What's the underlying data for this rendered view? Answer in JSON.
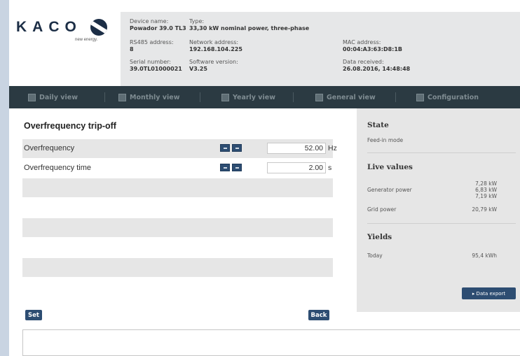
{
  "brand": {
    "logo_text": "KACO",
    "tagline": "new energy."
  },
  "device": {
    "name_label": "Device name:",
    "name_value": "Powador 39.0 TL3",
    "type_label": "Type:",
    "type_value": "33,30 kW nominal power, three-phase",
    "rs485_label": "RS485 address:",
    "rs485_value": "8",
    "network_label": "Network address:",
    "network_value": "192.168.104.225",
    "mac_label": "MAC address:",
    "mac_value": "00:04:A3:63:D8:1B",
    "serial_label": "Serial number:",
    "serial_value": "39.0TL01000021",
    "software_label": "Software version:",
    "software_value": "V3.25",
    "received_label": "Data received:",
    "received_value": "26.08.2016, 14:48:48"
  },
  "nav": [
    {
      "label": "Daily view",
      "icon": "calendar-day-icon"
    },
    {
      "label": "Monthly view",
      "icon": "calendar-month-icon"
    },
    {
      "label": "Yearly view",
      "icon": "calendar-year-icon"
    },
    {
      "label": "General view",
      "icon": "overview-icon"
    },
    {
      "label": "Configuration",
      "icon": "wrench-icon"
    }
  ],
  "main": {
    "title": "Overfrequency trip-off",
    "rows": [
      {
        "label": "Overfrequency",
        "value": "52.00",
        "unit": "Hz"
      },
      {
        "label": "Overfrequency time",
        "value": "2.00",
        "unit": "s"
      }
    ],
    "set_label": "Set",
    "back_label": "Back"
  },
  "sidebar": {
    "state_title": "State",
    "state_value": "Feed-in mode",
    "live_title": "Live values",
    "generator_label": "Generator power",
    "generator_values": [
      "7,28 kW",
      "6,83 kW",
      "7,19 kW"
    ],
    "grid_label": "Grid power",
    "grid_value": "20,79 kW",
    "yields_title": "Yields",
    "today_label": "Today",
    "today_value": "95,4 kWh",
    "export_label": "▸ Data export"
  },
  "colors": {
    "accent": "#2d4d72",
    "nav_bg": "#2b3a42",
    "panel_bg": "#e6e6e6"
  }
}
